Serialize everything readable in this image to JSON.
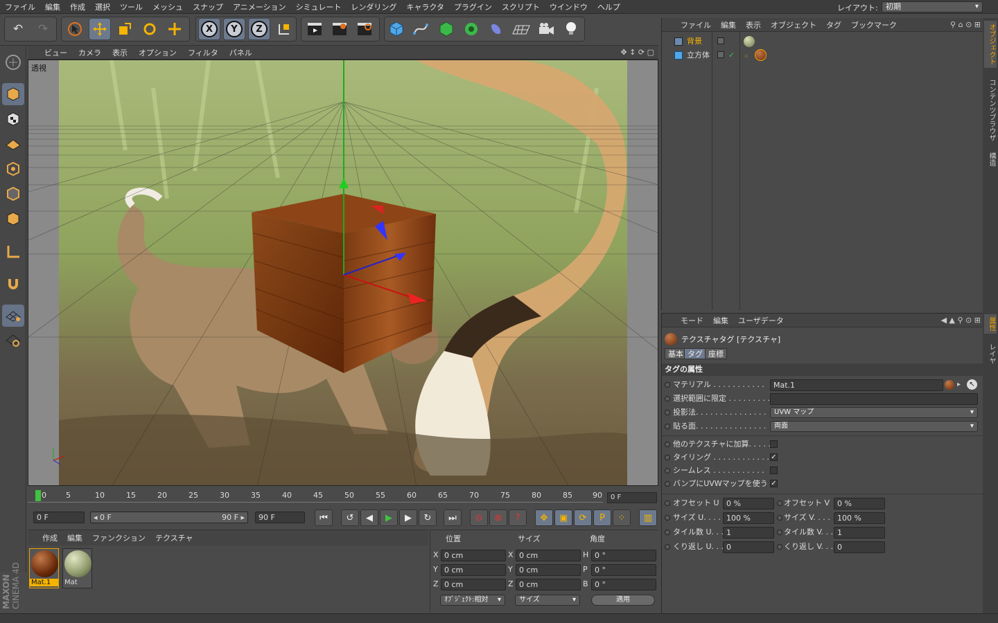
{
  "menubar": {
    "items": [
      "ファイル",
      "編集",
      "作成",
      "選択",
      "ツール",
      "メッシュ",
      "スナップ",
      "アニメーション",
      "シミュレート",
      "レンダリング",
      "キャラクタ",
      "プラグイン",
      "スクリプト",
      "ウインドウ",
      "ヘルプ"
    ],
    "layout_label": "レイアウト:",
    "layout_value": "初期"
  },
  "viewport": {
    "menu": [
      "ビュー",
      "カメラ",
      "表示",
      "オプション",
      "フィルタ",
      "パネル"
    ],
    "label": "透視"
  },
  "timeline": {
    "ticks": [
      "0",
      "5",
      "10",
      "15",
      "20",
      "25",
      "30",
      "35",
      "40",
      "45",
      "50",
      "55",
      "60",
      "65",
      "70",
      "75",
      "80",
      "85",
      "90"
    ],
    "current_frame": "0 F",
    "start": "0 F",
    "range_start": "◂ 0 F",
    "range_end": "90 F ▸",
    "end": "90 F"
  },
  "material_manager": {
    "menu": [
      "作成",
      "編集",
      "ファンクション",
      "テクスチャ"
    ],
    "materials": [
      {
        "name": "Mat.1",
        "selected": true
      },
      {
        "name": "Mat",
        "selected": false
      }
    ]
  },
  "coordinates": {
    "headers": {
      "position": "位置",
      "size": "サイズ",
      "angle": "角度"
    },
    "rows": [
      {
        "axis": "X",
        "pos": "0 cm",
        "size_axis": "X",
        "size": "0 cm",
        "rot_axis": "H",
        "rot": "0 °"
      },
      {
        "axis": "Y",
        "pos": "0 cm",
        "size_axis": "Y",
        "size": "0 cm",
        "rot_axis": "P",
        "rot": "0 °"
      },
      {
        "axis": "Z",
        "pos": "0 cm",
        "size_axis": "Z",
        "size": "0 cm",
        "rot_axis": "B",
        "rot": "0 °"
      }
    ],
    "mode_select": "ｵﾌﾞｼﾞｪｸﾄ:相対",
    "size_select": "サイズ",
    "apply_label": "適用"
  },
  "brand": {
    "line1": "MAXON",
    "line2": "CINEMA 4D"
  },
  "object_manager": {
    "menu": [
      "ファイル",
      "編集",
      "表示",
      "オブジェクト",
      "タグ",
      "ブックマーク"
    ],
    "objects": [
      {
        "name": "背景",
        "highlight": true
      },
      {
        "name": "立方体",
        "highlight": false
      }
    ]
  },
  "attribute_manager": {
    "menu": [
      "モード",
      "編集",
      "ユーザデータ"
    ],
    "title": "テクスチャタグ [テクスチャ]",
    "tabs": [
      "基本",
      "タグ",
      "座標"
    ],
    "section": "タグの属性",
    "material_label": "マテリアル . . . . . . . . . . .",
    "material_value": "Mat.1",
    "restrict_label": "選択範囲に限定 . . . . . . . . .",
    "projection_label": "投影法. . . . . . . . . . . . . . .",
    "projection_value": "UVW マップ",
    "side_label": "貼る面. . . . . . . . . . . . . . .",
    "side_value": "両面",
    "add_label": "他のテクスチャに加算. . . . .",
    "tile_label": "タイリング . . . . . . . . . . . .",
    "seamless_label": "シームレス . . . . . . . . . . .",
    "bump_label": "バンプにUVWマップを使う",
    "checks": {
      "add": false,
      "tile": true,
      "seamless": false,
      "bump": true
    },
    "offset_u_label": "オフセット U",
    "offset_u": "0 %",
    "offset_v_label": "オフセット V",
    "offset_v": "0 %",
    "size_u_label": "サイズ U. . . .",
    "size_u": "100 %",
    "size_v_label": "サイズ V. . . .",
    "size_v": "100 %",
    "tiles_u_label": "タイル数 U. . .",
    "tiles_u": "1",
    "tiles_v_label": "タイル数 V. . .",
    "tiles_v": "1",
    "repeat_u_label": "くり返し U. . .",
    "repeat_u": "0",
    "repeat_v_label": "くり返し V. . .",
    "repeat_v": "0"
  },
  "side_tabs": {
    "top": [
      "オブジェクト",
      "コンテンツブラウザ",
      "構造"
    ],
    "bottom": [
      "属性",
      "レイヤ"
    ]
  },
  "colors": {
    "accent": "#f4a400",
    "selection": "#6d7a8e",
    "panel": "#4a4a4a"
  }
}
